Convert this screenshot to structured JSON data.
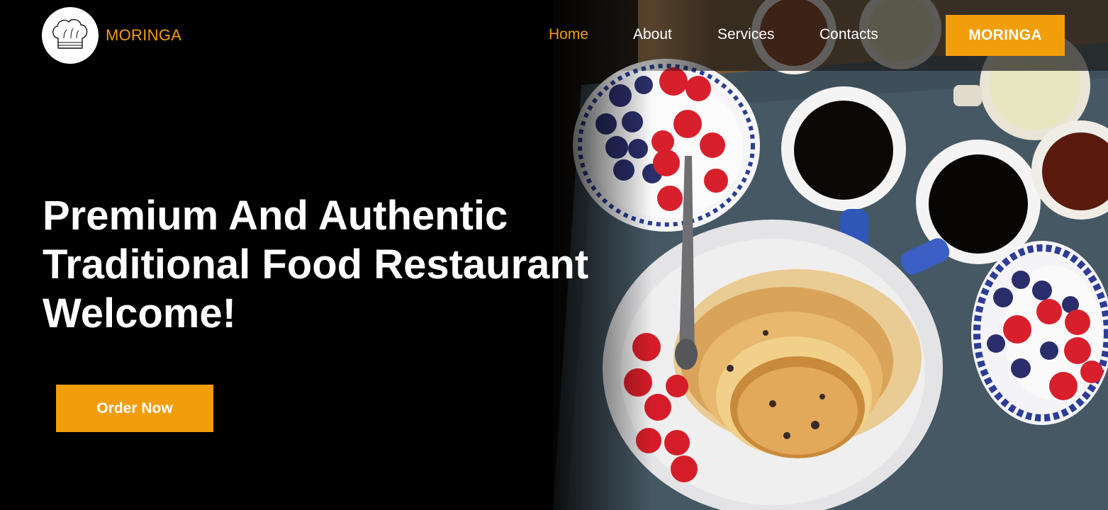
{
  "brand": {
    "name": "MORINGA",
    "logo_icon": "chef-hat-icon",
    "accent_color": "#f29d0a"
  },
  "nav": {
    "items": [
      {
        "label": "Home",
        "active": true
      },
      {
        "label": "About",
        "active": false
      },
      {
        "label": "Services",
        "active": false
      },
      {
        "label": "Contacts",
        "active": false
      }
    ],
    "cta_label": "MORINGA"
  },
  "hero": {
    "title_lines": [
      "Premium And Authentic",
      "Traditional Food Restaurant",
      "Welcome!"
    ],
    "button_label": "Order Now",
    "photo_icon": "breakfast-table-photo"
  }
}
